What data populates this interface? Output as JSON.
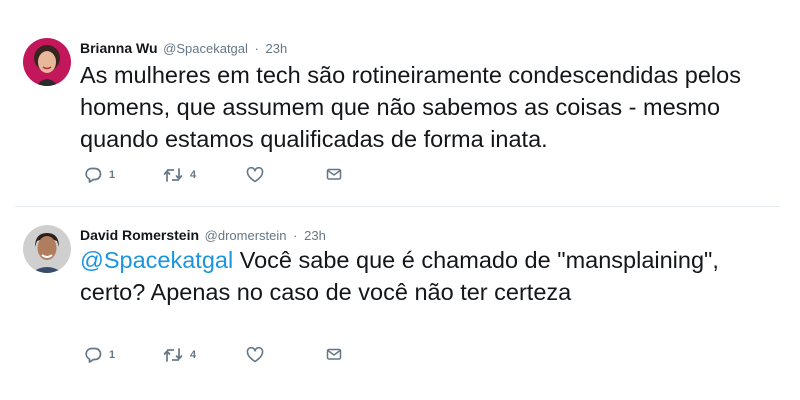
{
  "tweets": [
    {
      "name": "Brianna Wu",
      "handle": "@Spacekatgal",
      "separator": "·",
      "time": "23h",
      "mention": "",
      "text": "As mulheres em tech são rotineiramente condescendidas pelos homens, que assumem que não sabemos as coisas - mesmo quando estamos qualificadas de forma inata.",
      "replies": "1",
      "retweets": "4"
    },
    {
      "name": "David Romerstein",
      "handle": "@dromerstein",
      "separator": "·",
      "time": "23h",
      "mention": "@Spacekatgal",
      "text": " Você sabe que é chamado de \"mansplaining\", certo? Apenas no caso de você não ter certeza",
      "replies": "1",
      "retweets": "4"
    }
  ],
  "icons": {
    "reply": "reply-icon",
    "retweet": "retweet-icon",
    "like": "heart-icon",
    "dm": "envelope-icon"
  },
  "colors": {
    "link": "#1b95e0",
    "muted": "#657786",
    "text": "#14171a",
    "divider": "#e6ecf0"
  }
}
